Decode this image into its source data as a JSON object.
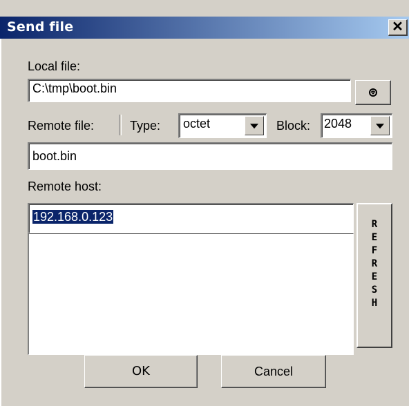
{
  "dialog": {
    "title": "Send file",
    "close_glyph": "✕"
  },
  "local_file": {
    "label": "Local file:",
    "value": "C:\\tmp\\boot.bin",
    "browse_icon": "browse-icon"
  },
  "remote_file": {
    "label": "Remote file:",
    "value": "boot.bin"
  },
  "type": {
    "label": "Type:",
    "value": "octet"
  },
  "block": {
    "label": "Block:",
    "value": "2048"
  },
  "remote_host": {
    "label": "Remote host:",
    "value": "192.168.0.123",
    "history": []
  },
  "refresh_label": [
    "R",
    "E",
    "F",
    "R",
    "E",
    "S",
    "H"
  ],
  "buttons": {
    "ok": "OK",
    "cancel": "Cancel"
  },
  "colors": {
    "titlebar_start": "#0a246a",
    "titlebar_end": "#a6caf0",
    "dialog_bg": "#d4d0c8",
    "selection": "#0a246a"
  }
}
